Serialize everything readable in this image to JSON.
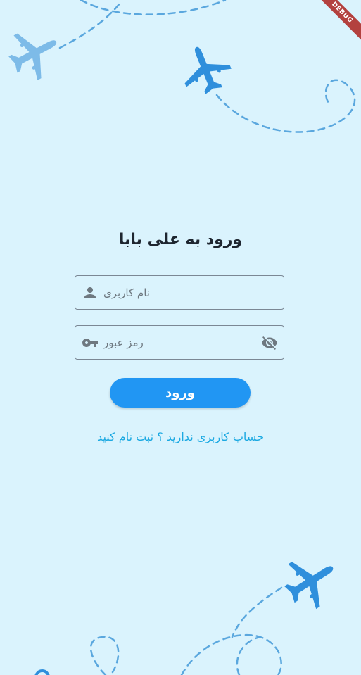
{
  "debug_banner": "DEBUG",
  "login": {
    "title": "ورود به علی بابا",
    "username_placeholder": "نام کاربری",
    "password_placeholder": "رمز عبور",
    "submit_label": "ورود",
    "signup_text": "حساب کاربری ندارید ؟ ثبت نام کنید"
  },
  "icons": {
    "username": "person-icon",
    "password": "key-icon",
    "toggle_visibility": "visibility-off-icon",
    "decoration": "airplane-icon"
  },
  "colors": {
    "background": "#DAF3FD",
    "primary": "#2196F3",
    "link": "#1BA9E2",
    "plane": "#2F8FDC",
    "plane_light": "#7DBBE8"
  }
}
